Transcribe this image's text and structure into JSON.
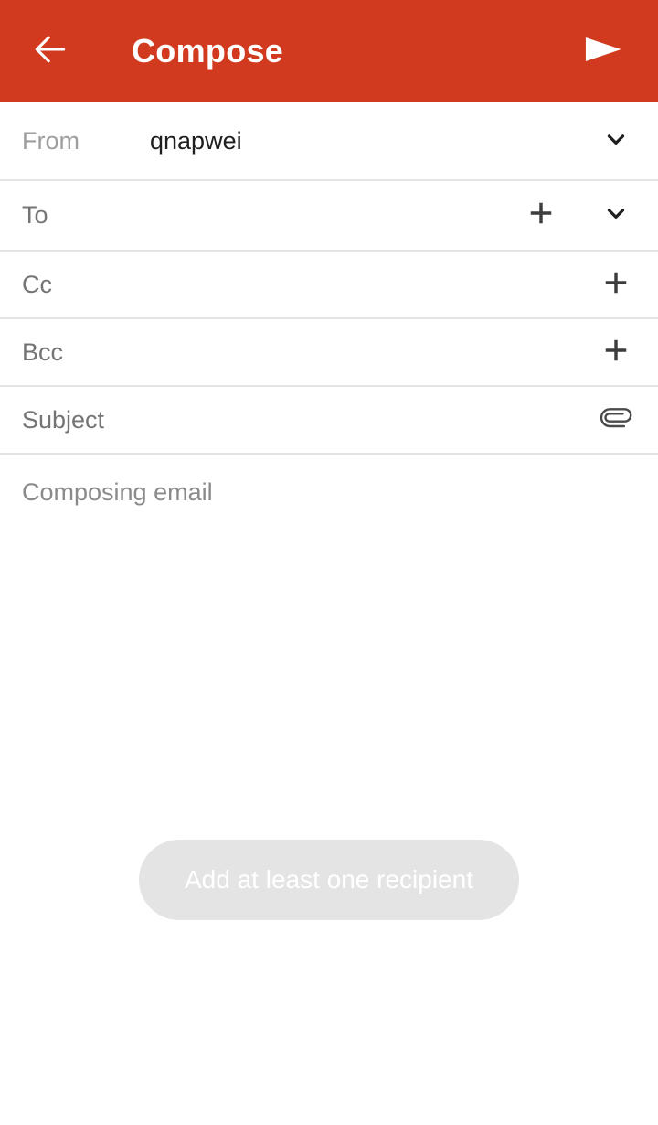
{
  "appbar": {
    "back_icon": "arrow-left-icon",
    "title": "Compose",
    "send_icon": "send-icon",
    "background_color": "#d23a1f",
    "foreground_color": "#ffffff"
  },
  "fields": {
    "from": {
      "label": "From",
      "value": "qnapwei",
      "dropdown_icon": "chevron-down-icon"
    },
    "to": {
      "label": "To",
      "value": "",
      "add_icon": "plus-icon",
      "dropdown_icon": "chevron-down-icon"
    },
    "cc": {
      "label": "Cc",
      "value": "",
      "add_icon": "plus-icon"
    },
    "bcc": {
      "label": "Bcc",
      "value": "",
      "add_icon": "plus-icon"
    },
    "subject": {
      "label": "Subject",
      "value": "",
      "attach_icon": "paperclip-icon"
    }
  },
  "body": {
    "placeholder": "Composing email",
    "value": ""
  },
  "toast": {
    "message": "Add at least one recipient",
    "background_color": "#e4e4e4",
    "text_color": "#ffffff"
  }
}
